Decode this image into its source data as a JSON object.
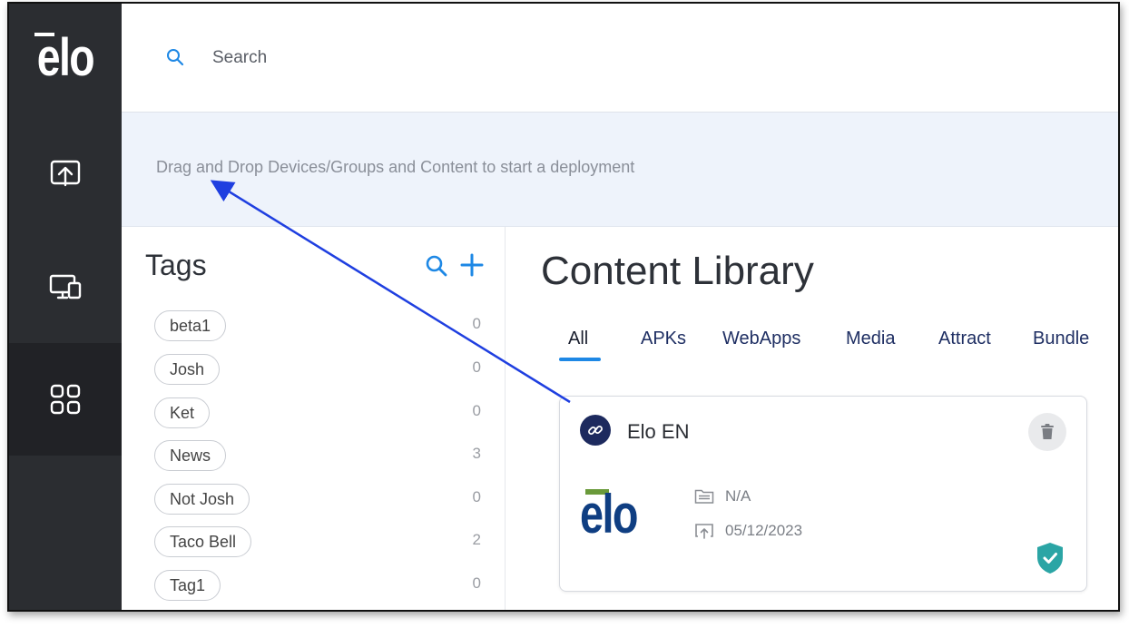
{
  "sidebar": {
    "logo_text": "elo",
    "nav": [
      {
        "icon": "upload-screen-icon"
      },
      {
        "icon": "devices-icon"
      },
      {
        "icon": "grid-icon",
        "active": true
      }
    ]
  },
  "search": {
    "placeholder": "Search"
  },
  "deployment": {
    "hint": "Drag and Drop Devices/Groups and Content to start a deployment"
  },
  "tags": {
    "title": "Tags",
    "items": [
      {
        "label": "beta1",
        "count": "0"
      },
      {
        "label": "Josh",
        "count": "0"
      },
      {
        "label": "Ket",
        "count": "0"
      },
      {
        "label": "News",
        "count": "3"
      },
      {
        "label": "Not Josh",
        "count": "0"
      },
      {
        "label": "Taco Bell",
        "count": "2"
      },
      {
        "label": "Tag1",
        "count": "0"
      }
    ]
  },
  "content_library": {
    "title": "Content Library",
    "tabs": [
      {
        "label": "All",
        "active": true
      },
      {
        "label": "APKs"
      },
      {
        "label": "WebApps"
      },
      {
        "label": "Media"
      },
      {
        "label": "Attract"
      },
      {
        "label": "Bundle"
      }
    ],
    "card": {
      "title": "Elo EN",
      "thumb_text": "elo",
      "folder": "N/A",
      "upload_date": "05/12/2023"
    }
  },
  "colors": {
    "sidebar_bg": "#2b2d31",
    "accent_blue": "#1e88e5",
    "shield_teal": "#2ba5a5",
    "annotation_arrow": "#1f3fe0"
  }
}
